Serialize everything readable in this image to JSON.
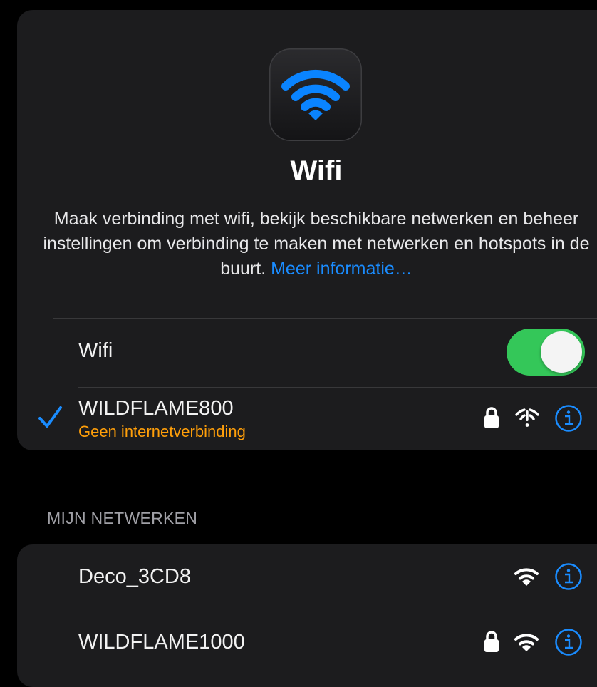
{
  "wifi_panel": {
    "icon": "wifi-app-icon",
    "title": "Wifi",
    "description": "Maak verbinding met wifi, bekijk beschikbare netwerken en beheer instellingen om verbinding te maken met netwerken en hotspots in de buurt.",
    "more_info_link": "Meer informatie…",
    "toggle_label": "Wifi",
    "toggle_on": true,
    "connected": {
      "name": "WILDFLAME800",
      "status": "Geen internetverbinding",
      "secured": true,
      "signal_icon": "wifi-no-internet-icon"
    }
  },
  "my_networks": {
    "header": "MIJN NETWERKEN",
    "items": [
      {
        "name": "Deco_3CD8",
        "secured": false,
        "signal_icon": "wifi-icon"
      },
      {
        "name": "WILDFLAME1000",
        "secured": true,
        "signal_icon": "wifi-icon"
      }
    ]
  },
  "colors": {
    "accent": "#1a8cff",
    "toggle_on": "#34c759",
    "warning": "#ff9f0a",
    "card_bg": "#1c1c1e"
  }
}
